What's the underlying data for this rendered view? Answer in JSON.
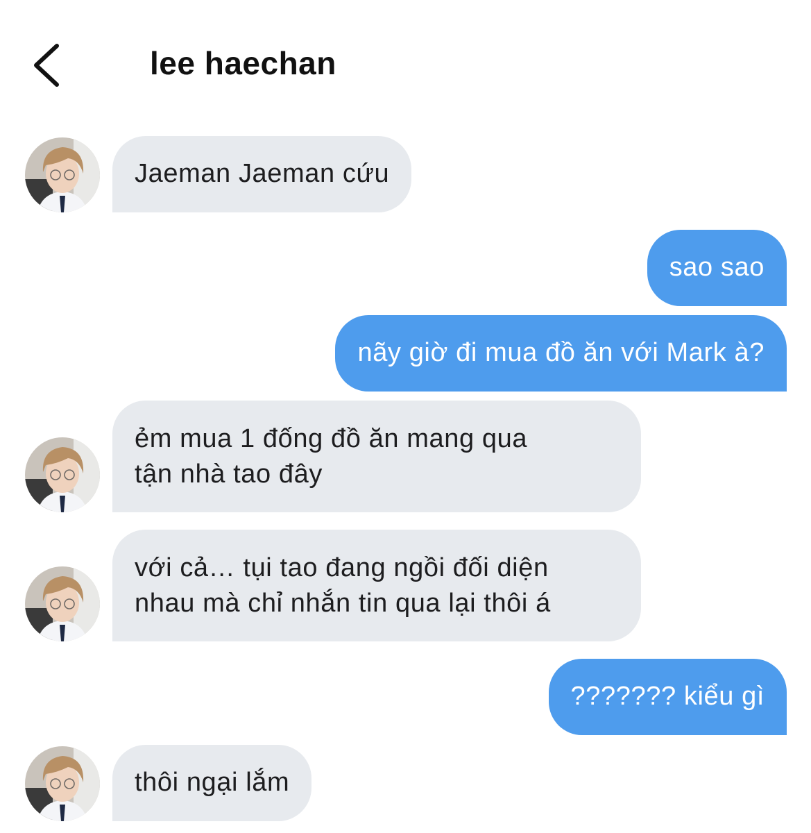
{
  "header": {
    "back_icon": "chevron-left-icon",
    "title": "lee haechan"
  },
  "colors": {
    "incoming_bubble": "#e7eaee",
    "outgoing_bubble": "#4e9ced",
    "background": "#ffffff"
  },
  "messages": [
    {
      "direction": "incoming",
      "lines": [
        "Jaeman Jaeman cứu"
      ]
    },
    {
      "direction": "outgoing",
      "lines": [
        "sao sao"
      ]
    },
    {
      "direction": "outgoing",
      "lines": [
        "nãy giờ đi mua đồ ăn với Mark à?"
      ]
    },
    {
      "direction": "incoming",
      "lines": [
        "ẻm mua 1 đống đồ ăn mang qua",
        "tận nhà tao đây"
      ]
    },
    {
      "direction": "incoming",
      "lines": [
        "với cả… tụi tao đang ngồi đối diện",
        "nhau mà chỉ nhắn tin qua lại thôi á"
      ]
    },
    {
      "direction": "outgoing",
      "lines": [
        "??????? kiểu gì"
      ]
    },
    {
      "direction": "incoming",
      "lines": [
        "thôi ngại lắm"
      ]
    }
  ]
}
